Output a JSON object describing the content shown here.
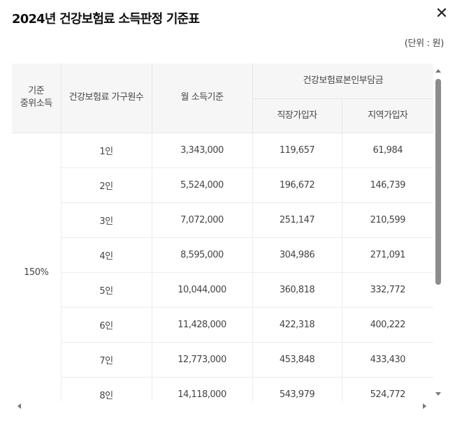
{
  "modal": {
    "title": "2024년 건강보험료 소득판정 기준표",
    "close_glyph": "✕",
    "unit_note": "(단위 : 원)"
  },
  "table": {
    "headers": {
      "income_level": "기준\n중위소득",
      "household_size": "건강보험료 가구원수",
      "monthly_income": "월 소득기준",
      "self_pay": "건강보험료본인부담금",
      "employee": "직장가입자",
      "regional": "지역가입자"
    },
    "income_level_value": "150%",
    "rows": [
      {
        "household": "1인",
        "income": "3,343,000",
        "employee": "119,657",
        "regional": "61,984"
      },
      {
        "household": "2인",
        "income": "5,524,000",
        "employee": "196,672",
        "regional": "146,739"
      },
      {
        "household": "3인",
        "income": "7,072,000",
        "employee": "251,147",
        "regional": "210,599"
      },
      {
        "household": "4인",
        "income": "8,595,000",
        "employee": "304,986",
        "regional": "271,091"
      },
      {
        "household": "5인",
        "income": "10,044,000",
        "employee": "360,818",
        "regional": "332,772"
      },
      {
        "household": "6인",
        "income": "11,428,000",
        "employee": "422,318",
        "regional": "400,222"
      },
      {
        "household": "7인",
        "income": "12,773,000",
        "employee": "453,848",
        "regional": "433,430"
      },
      {
        "household": "8인",
        "income": "14,118,000",
        "employee": "543,979",
        "regional": "524,772"
      }
    ]
  },
  "scroll": {
    "vertical_thumb_fraction": 0.67
  }
}
